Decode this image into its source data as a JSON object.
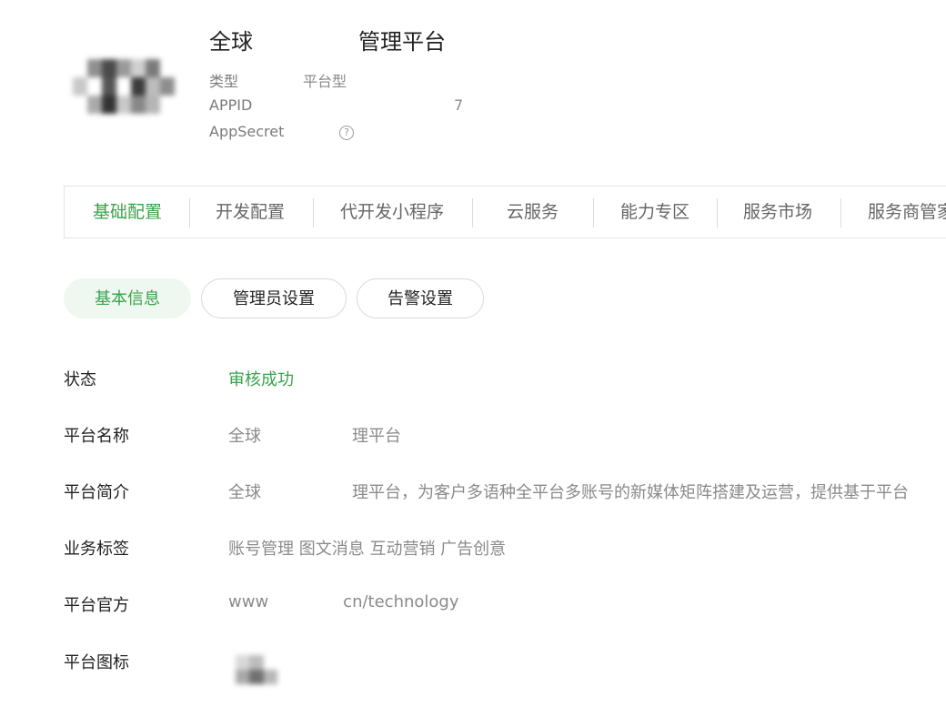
{
  "header": {
    "title_start": "全球",
    "title_end": "管理平台",
    "type_label": "类型",
    "type_value": "平台型",
    "appid_label": "APPID",
    "appid_tail": "7",
    "secret_label": "AppSecret",
    "help_glyph": "?"
  },
  "tabs": [
    "基础配置",
    "开发配置",
    "代开发小程序",
    "云服务",
    "能力专区",
    "服务市场",
    "服务商管家"
  ],
  "sub_tabs": [
    "基本信息",
    "管理员设置",
    "告警设置"
  ],
  "info": {
    "status_label": "状态",
    "status_value": "审核成功",
    "name_label": "平台名称",
    "name_start": "全球",
    "name_end": "理平台",
    "intro_label": "平台简介",
    "intro_start": "全球",
    "intro_end": "理平台，为客户多语种全平台多账号的新媒体矩阵搭建及运营，提供基于平台",
    "tags_label": "业务标签",
    "tags_value": "账号管理 图文消息 互动营销 广告创意",
    "site_label": "平台官方",
    "site_start": "www",
    "site_end": "cn/technology",
    "icon_label": "平台图标"
  },
  "colors": {
    "accent": "#3aa24b",
    "active_pill_bg": "#eef8f0",
    "muted_text": "#8a8a8a"
  }
}
